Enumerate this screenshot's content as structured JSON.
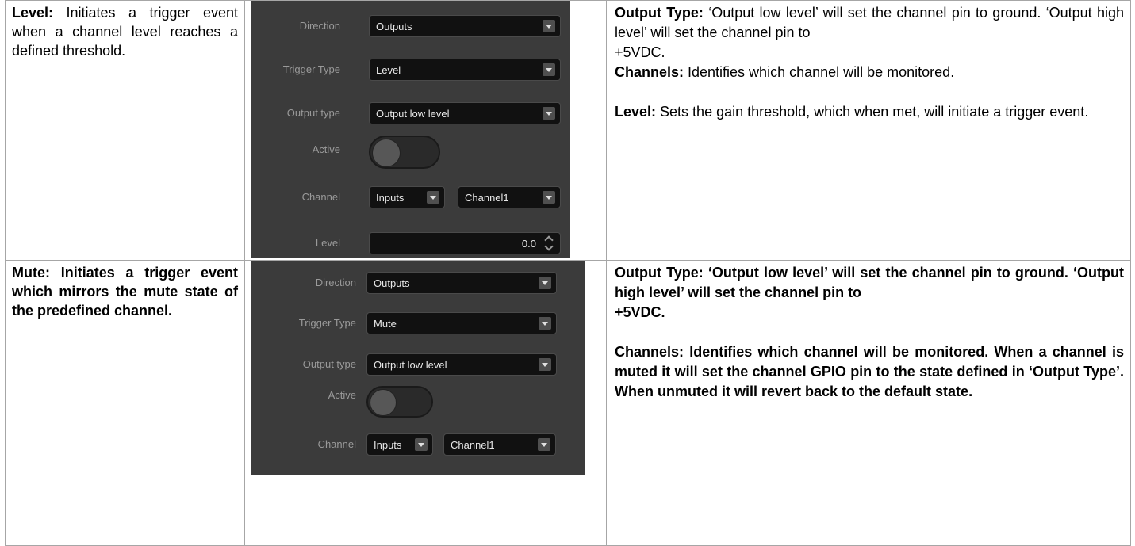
{
  "rows": [
    {
      "left": {
        "label": "Level:",
        "text": " Initiates a trigger event when a channel level reaches a defined threshold."
      },
      "panel": {
        "direction_label": "Direction",
        "direction_value": "Outputs",
        "trigger_type_label": "Trigger Type",
        "trigger_type_value": "Level",
        "output_type_label": "Output type",
        "output_type_value": "Output low level",
        "active_label": "Active",
        "channel_label": "Channel",
        "channel_group_value": "Inputs",
        "channel_value": "Channel1",
        "level_label": "Level",
        "level_value": "0.0"
      },
      "right": {
        "p1_label": "Output Type:",
        "p1_text": " ‘Output low level’ will set the channel pin to ground. ‘Output high level’ will set the channel pin to",
        "p2_text": "+5VDC.",
        "p3_label": "Channels:",
        "p3_text": " Identifies which channel will be monitored.",
        "p4_label": "Level:",
        "p4_text": " Sets the gain threshold, which when met, will initiate a trigger event."
      }
    },
    {
      "left": {
        "text": "Mute: Initiates a trigger event which mirrors the mute state of the predefined channel."
      },
      "panel": {
        "direction_label": "Direction",
        "direction_value": "Outputs",
        "trigger_type_label": "Trigger Type",
        "trigger_type_value": "Mute",
        "output_type_label": "Output type",
        "output_type_value": "Output low level",
        "active_label": "Active",
        "channel_label": "Channel",
        "channel_group_value": "Inputs",
        "channel_value": "Channel1"
      },
      "right": {
        "p1_text": "Output Type: ‘Output low level’ will set the channel pin to ground. ‘Output high level’ will set the channel pin to",
        "p2_text": "+5VDC.",
        "p3_text": "Channels: Identifies which channel will be monitored. When a channel is muted it will set the channel GPIO pin to the state defined in ‘Output Type’. When unmuted it will revert back to the default state."
      }
    }
  ]
}
